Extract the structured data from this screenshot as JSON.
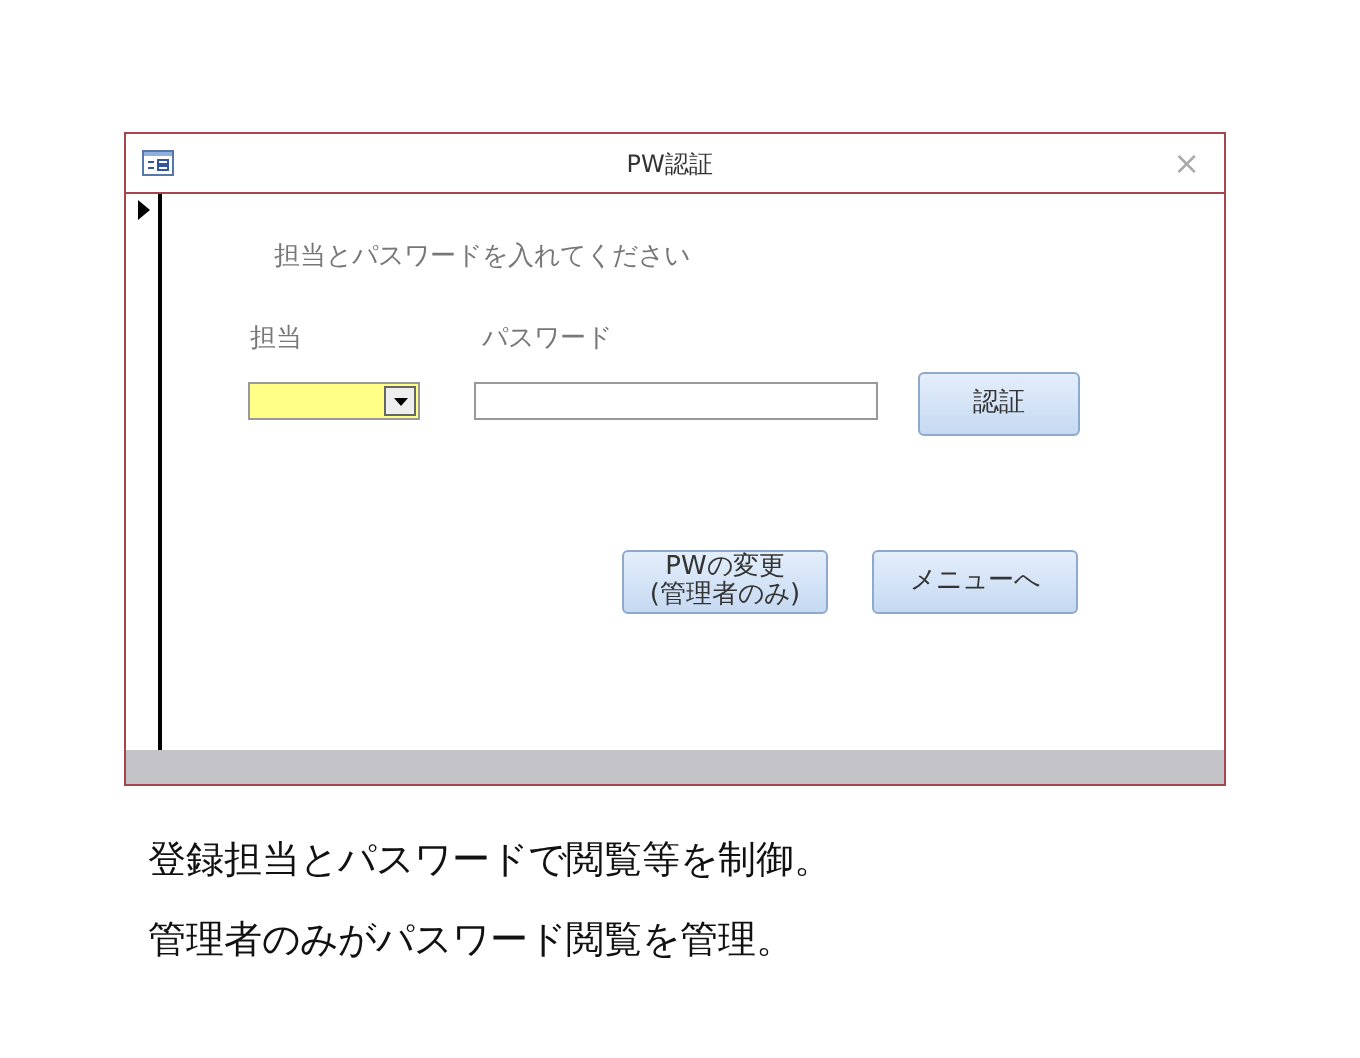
{
  "window": {
    "title": "PW認証",
    "close": "×"
  },
  "form": {
    "instruction": "担当とパスワードを入れてください",
    "fields": [
      {
        "kind": "combo",
        "label": "担当"
      },
      {
        "kind": "text",
        "label": "パスワード"
      }
    ],
    "buttons": [
      {
        "kind": "auth",
        "label": "認証"
      },
      {
        "kind": "change",
        "label": "PWの変更\n(管理者のみ)"
      },
      {
        "kind": "menu",
        "label": "メニューへ"
      }
    ]
  },
  "captions": [
    "登録担当とパスワードで閲覧等を制御。",
    "管理者のみがパスワード閲覧を管理。"
  ]
}
